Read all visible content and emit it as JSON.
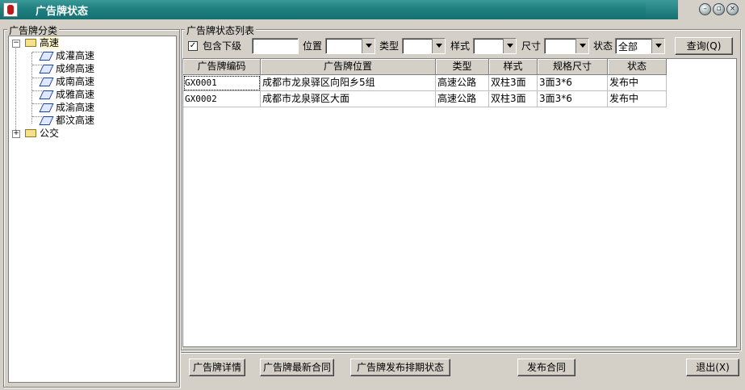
{
  "window": {
    "title": "广告牌状态"
  },
  "left_panel": {
    "group_label": "广告牌分类",
    "tree": [
      {
        "label": "高速",
        "expanded": true,
        "children": [
          "成灌高速",
          "成绵高速",
          "成南高速",
          "成雅高速",
          "成渝高速",
          "都汶高速"
        ]
      },
      {
        "label": "公交",
        "expanded": false,
        "children": []
      }
    ]
  },
  "right_panel": {
    "group_label": "广告牌状态列表",
    "filters": {
      "include_sub_label": "包含下级",
      "include_sub_checked": true,
      "keyword_value": "",
      "location_label": "位置",
      "location_value": "",
      "type_label": "类型",
      "type_value": "",
      "style_label": "样式",
      "style_value": "",
      "size_label": "尺寸",
      "size_value": "",
      "status_label": "状态",
      "status_value": "全部",
      "query_label": "查询(Q)"
    },
    "table": {
      "columns": [
        "广告牌编码",
        "广告牌位置",
        "类型",
        "样式",
        "规格尺寸",
        "状态"
      ],
      "rows": [
        [
          "GX0001",
          "成都市龙泉驿区向阳乡5组",
          "高速公路",
          "双柱3面",
          "3面3*6",
          "发布中"
        ],
        [
          "GX0002",
          "成都市龙泉驿区大面",
          "高速公路",
          "双柱3面",
          "3面3*6",
          "发布中"
        ]
      ]
    }
  },
  "bottom_buttons": {
    "details": "广告牌详情",
    "latest_contract": "广告牌最新合同",
    "schedule_status": "广告牌发布排期状态",
    "publish_contract": "发布合同",
    "exit": "退出(X)"
  }
}
